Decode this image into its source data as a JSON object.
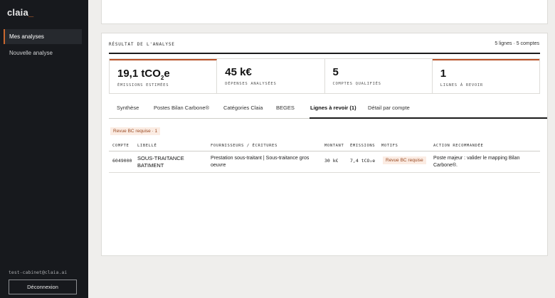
{
  "sidebar": {
    "logo": "claia",
    "logo_cursor": "_",
    "items": [
      {
        "label": "Mes analyses",
        "active": true
      },
      {
        "label": "Nouvelle analyse",
        "active": false
      }
    ],
    "user_email": "test-cabinet@claia.ai",
    "logout_label": "Déconnexion"
  },
  "colors": {
    "accent": "#c9672e",
    "sidebar_bg": "#17191d",
    "badge_bg": "#fbece3",
    "badge_text": "#9a4a23"
  },
  "result": {
    "title": "RÉSULTAT DE L'ANALYSE",
    "meta": "5 lignes · 5 comptes",
    "kpis": [
      {
        "value_main": "19,1 tCO",
        "value_sub": "2",
        "value_tail": "e",
        "label": "Émissions estimées"
      },
      {
        "value": "45 k€",
        "label": "Dépenses analysées"
      },
      {
        "value": "5",
        "label": "Comptes qualifiés"
      },
      {
        "value": "1",
        "label": "Lignes à revoir"
      }
    ],
    "tabs": [
      "Synthèse",
      "Postes Bilan Carbone®",
      "Catégories Claia",
      "BEGES",
      "Lignes à revoir (1)",
      "Détail par compte"
    ],
    "active_tab": "Lignes à revoir (1)",
    "filter_chip": "Revue BC requise · 1",
    "table": {
      "headers": [
        "COMPTE",
        "LIBELLÉ",
        "FOURNISSEURS / ÉCRITURES",
        "MONTANT",
        "ÉMISSIONS",
        "MOTIFS",
        "ACTION RECOMMANDÉE"
      ],
      "rows": [
        {
          "compte": "6049000",
          "libelle_line1": "SOUS-TRAITANCE",
          "libelle_line2": "BATIMENT",
          "fournisseurs_line1": "Prestation sous-traitant | Sous-traitance gros",
          "fournisseurs_line2": "oeuvre",
          "montant": "30 k€",
          "emissions": "7,4 tCO₂e",
          "motif": "Revue BC requise",
          "action_line1": "Poste majeur : valider le mapping Bilan",
          "action_line2": "Carbone®."
        }
      ]
    }
  }
}
